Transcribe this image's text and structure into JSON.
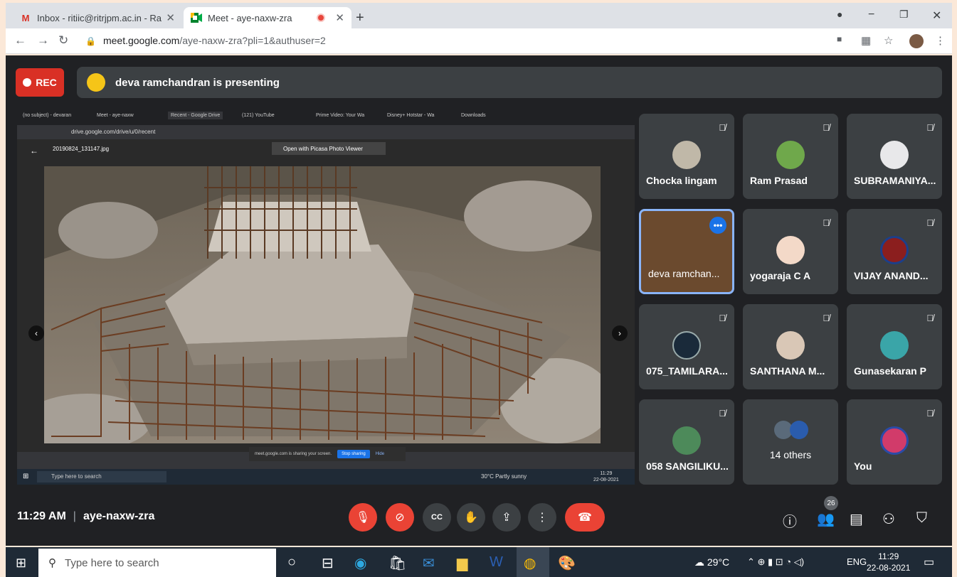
{
  "browser": {
    "tabs": [
      {
        "title": "Inbox - ritiic@ritrjpm.ac.in - Ram",
        "favicon": "gmail-icon"
      },
      {
        "title": "Meet - aye-naxw-zra",
        "favicon": "meet-icon",
        "active": true
      }
    ],
    "url_host": "meet.google.com",
    "url_path": "/aye-naxw-zra?pli=1&authuser=2"
  },
  "meet": {
    "rec_label": "REC",
    "presenting_text": "deva ramchandran is presenting",
    "meeting_time": "11:29 AM",
    "meeting_code": "aye-naxw-zra",
    "participants_count": "26",
    "tiles": [
      {
        "name": "Chocka lingam",
        "muted": true
      },
      {
        "name": "Ram Prasad",
        "muted": true
      },
      {
        "name": "SUBRAMANIYA...",
        "muted": true
      },
      {
        "name": "deva ramchan...",
        "muted": false,
        "speaking": true
      },
      {
        "name": "yogaraja C A",
        "muted": true
      },
      {
        "name": "VIJAY ANAND...",
        "muted": true
      },
      {
        "name": "075_TAMILARA...",
        "muted": true
      },
      {
        "name": "SANTHANA M...",
        "muted": true
      },
      {
        "name": "Gunasekaran P",
        "muted": true
      },
      {
        "name": "058 SANGILIKU...",
        "muted": true
      },
      {
        "name": "14 others",
        "muted": false
      },
      {
        "name": "You",
        "muted": true
      }
    ]
  },
  "shared_screen": {
    "tabs": [
      "(no subject) - devaran",
      "Meet - aye-naxw",
      "Recent - Google Drive",
      "(121) YouTube",
      "Prime Video: Your Wa",
      "Disney+ Hotstar - Wa",
      "Downloads"
    ],
    "url": "drive.google.com/drive/u/0/recent",
    "file_name": "20190824_131147.jpg",
    "open_with": "Open with Picasa Photo Viewer",
    "sharing_text": "meet.google.com is sharing your screen.",
    "stop_sharing": "Stop sharing",
    "hide": "Hide",
    "taskbar_search": "Type here to search",
    "weather": "30°C  Partly sunny",
    "time": "11:29",
    "date": "22-08-2021"
  },
  "taskbar": {
    "search_placeholder": "Type here to search",
    "weather": "29°C",
    "language": "ENG",
    "time": "11:29",
    "date": "22-08-2021"
  }
}
